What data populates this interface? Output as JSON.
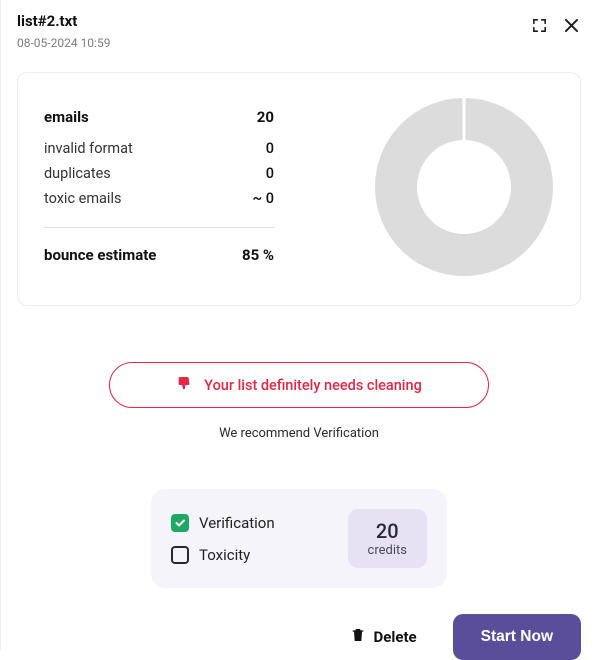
{
  "header": {
    "filename": "list#2.txt",
    "timestamp": "08-05-2024 10:59"
  },
  "stats": {
    "emails_label": "emails",
    "emails_value": "20",
    "rows": [
      {
        "label": "invalid format",
        "value": "0"
      },
      {
        "label": "duplicates",
        "value": "0"
      },
      {
        "label": "toxic emails",
        "value": "~ 0"
      }
    ],
    "bounce_label": "bounce estimate",
    "bounce_value": "85 %"
  },
  "chart_data": {
    "type": "pie",
    "title": "",
    "series": [
      {
        "name": "segment",
        "value": 100,
        "color": "#dcdcdc"
      }
    ]
  },
  "banner": {
    "text": "Your list definitely needs cleaning"
  },
  "recommend": "We recommend Verification",
  "options": {
    "verification_label": "Verification",
    "toxicity_label": "Toxicity",
    "credits_value": "20",
    "credits_label": "credits"
  },
  "footer": {
    "delete_label": "Delete",
    "start_label": "Start Now"
  }
}
